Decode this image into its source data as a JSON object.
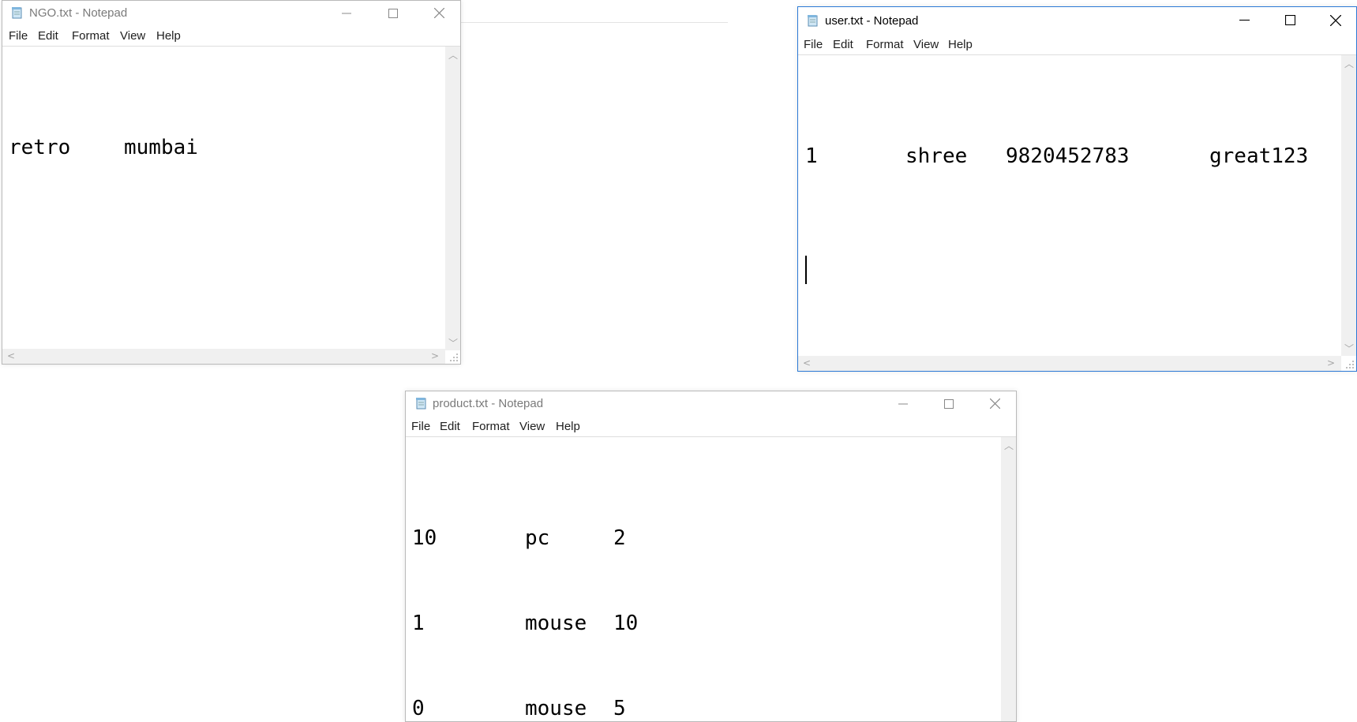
{
  "windows": {
    "ngo": {
      "title": "NGO.txt - Notepad",
      "menu": [
        "File",
        "Edit",
        "Format",
        "View",
        "Help"
      ],
      "lines": [
        [
          "retro",
          "mumbai"
        ]
      ]
    },
    "user": {
      "title": "user.txt - Notepad",
      "menu": [
        "File",
        "Edit",
        "Format",
        "View",
        "Help"
      ],
      "lines": [
        [
          "1",
          "shree",
          "9820452783",
          "great123"
        ]
      ]
    },
    "product": {
      "title": "product.txt - Notepad",
      "menu": [
        "File",
        "Edit",
        "Format",
        "View",
        "Help"
      ],
      "lines": [
        [
          "10",
          "pc",
          "2"
        ],
        [
          "1",
          "mouse",
          "10"
        ],
        [
          "0",
          "mouse",
          "5"
        ]
      ]
    }
  },
  "colors": {
    "active_border": "#2b79d6",
    "inactive_title": "#7a7a7a",
    "scrollbar_bg": "#f0f0f0"
  },
  "icons": [
    "notepad-icon",
    "minimize-icon",
    "maximize-icon",
    "close-icon",
    "scroll-up-arrow-icon",
    "scroll-down-arrow-icon",
    "scroll-left-arrow-icon",
    "scroll-right-arrow-icon",
    "resize-grip-icon"
  ]
}
